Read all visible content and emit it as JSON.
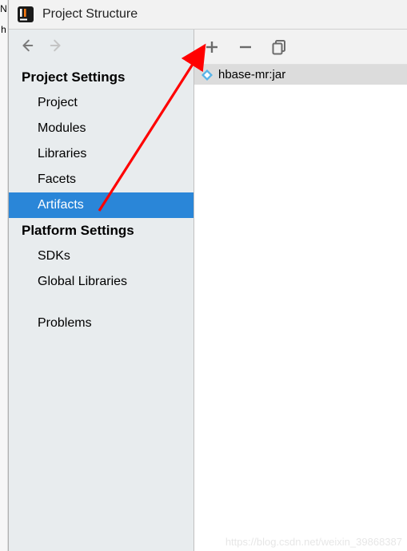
{
  "window": {
    "title": "Project Structure"
  },
  "sidebar": {
    "sections": {
      "project_settings": {
        "label": "Project Settings",
        "items": [
          "Project",
          "Modules",
          "Libraries",
          "Facets",
          "Artifacts"
        ]
      },
      "platform_settings": {
        "label": "Platform Settings",
        "items": [
          "SDKs",
          "Global Libraries"
        ]
      },
      "other": {
        "items": [
          "Problems"
        ]
      }
    },
    "selected": "Artifacts"
  },
  "toolbar": {
    "add_label": "Add",
    "remove_label": "Remove",
    "copy_label": "Copy"
  },
  "artifacts": [
    {
      "name": "hbase-mr:jar",
      "icon": "artifact-diamond"
    }
  ],
  "watermark": "https://blog.csdn.net/weixin_39868387",
  "left_edge": {
    "n": "N",
    "h": "h"
  }
}
